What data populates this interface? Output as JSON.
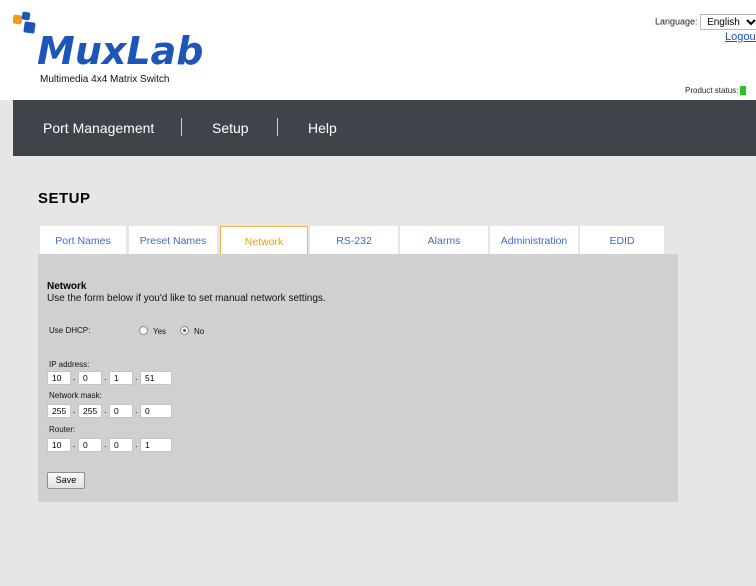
{
  "header": {
    "brand": "MuxLab",
    "subtitle": "Multimedia 4x4 Matrix Switch",
    "language_label": "Language:",
    "language_value": "English",
    "logout_label": "Logout",
    "product_status_label": "Product status:",
    "product_status_color": "#23c423"
  },
  "nav": {
    "items": [
      "Port Management",
      "Setup",
      "Help"
    ]
  },
  "page": {
    "title": "SETUP"
  },
  "tabs": {
    "items": [
      "Port Names",
      "Preset Names",
      "Network",
      "RS-232",
      "Alarms",
      "Administration",
      "EDID"
    ],
    "active": "Network"
  },
  "network": {
    "title": "Network",
    "description": "Use the form below if you'd like to set manual network settings.",
    "dhcp_label": "Use DHCP:",
    "dhcp_yes": "Yes",
    "dhcp_no": "No",
    "dhcp_selected": "No",
    "ip_label": "IP address:",
    "ip": [
      "10",
      "0",
      "1",
      "51"
    ],
    "mask_label": "Network mask:",
    "mask": [
      "255",
      "255",
      "0",
      "0"
    ],
    "router_label": "Router:",
    "router": [
      "10",
      "0",
      "0",
      "1"
    ],
    "save_label": "Save"
  },
  "colors": {
    "nav_bg": "#40444a",
    "active_tab": "#f39a16",
    "tab_text": "#4169c8",
    "logo_blue": "#1c56b8",
    "logo_orange": "#f39a16"
  }
}
